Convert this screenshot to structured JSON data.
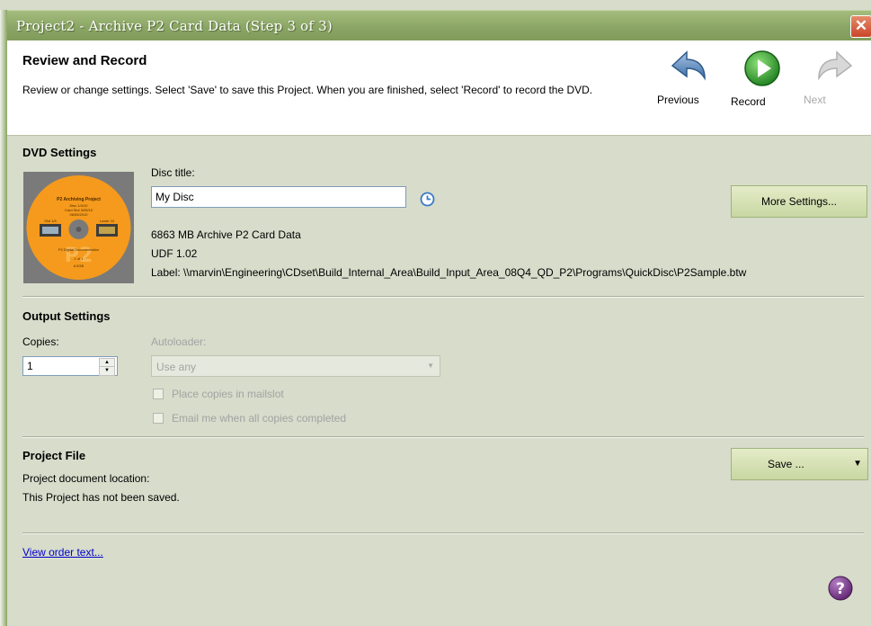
{
  "window": {
    "title": "Project2 - Archive P2 Card Data (Step 3 of 3)",
    "close_icon": "close-icon"
  },
  "header": {
    "title": "Review and Record",
    "description": "Review or change settings.  Select 'Save' to save this Project.  When you are finished, select 'Record' to record the DVD.",
    "previous_label": "Previous",
    "record_label": "Record",
    "next_label": "Next"
  },
  "dvd_settings": {
    "heading": "DVD Settings",
    "disc_title_label": "Disc title:",
    "disc_title_value": "My Disc",
    "size_info": "6863 MB Archive P2 Card Data",
    "format": "UDF 1.02",
    "label_path": "Label: \\\\marvin\\Engineering\\CDset\\Build_Internal_Area\\Build_Input_Area_08Q4_QD_P2\\Programs\\QuickDisc\\P2Sample.btw",
    "more_settings_label": "More Settings...",
    "disc_art": {
      "title": "P2 Archiving Project",
      "lines": [
        "Disc 1/4/10",
        "Card Slot 3/05/10",
        "06/05/2010"
      ],
      "left_thumb_caption": "Slot 1/5",
      "right_thumb_caption": "Lower 10",
      "bottom_lines": [
        "P2 Digital Documentation",
        "1 of 1",
        "6.0GB"
      ],
      "watermark": "P2",
      "colors": {
        "disc": "#f59a1c",
        "hub": "#7a7a7a"
      }
    }
  },
  "output_settings": {
    "heading": "Output Settings",
    "copies_label": "Copies:",
    "copies_value": "1",
    "autoloader_label": "Autoloader:",
    "autoloader_value": "Use any",
    "mailslot_label": "Place copies in mailslot",
    "email_label": "Email me when all copies completed"
  },
  "project_file": {
    "heading": "Project File",
    "location_label": "Project document location:",
    "status": "This Project has not been saved.",
    "save_label": "Save ..."
  },
  "footer": {
    "view_order_link": "View order text..."
  },
  "colors": {
    "accent_green": "#8aa565",
    "record_green": "#2e9a2e",
    "help_purple": "#6b2d7a"
  }
}
